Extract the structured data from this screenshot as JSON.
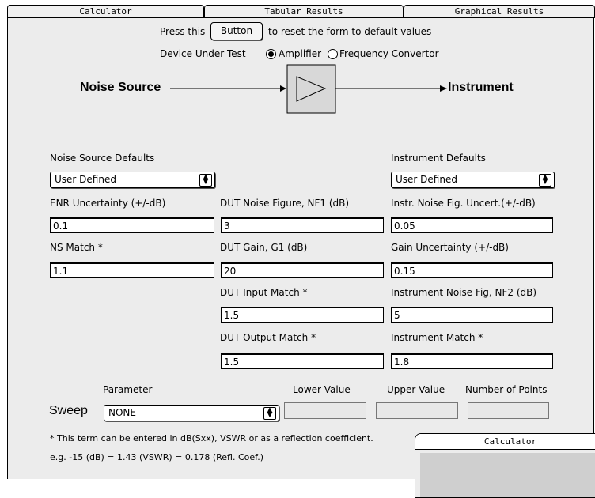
{
  "tabs": [
    "Calculator",
    "Tabular Results",
    "Graphical Results"
  ],
  "reset": {
    "prefix": "Press this",
    "button": "Button",
    "suffix": "to reset the form to default values"
  },
  "device": {
    "label": "Device Under Test",
    "option_amplifier": "Amplifier",
    "option_converter": "Frequency Convertor",
    "selected": "Amplifier"
  },
  "diagram": {
    "source": "Noise Source",
    "instrument": "Instrument"
  },
  "noise_source": {
    "defaults_label": "Noise Source Defaults",
    "defaults_value": "User Defined",
    "enr_label": "ENR Uncertainty (+/-dB)",
    "enr_value": "0.1",
    "match_label": "NS Match *",
    "match_value": "1.1"
  },
  "dut": {
    "nf_label": "DUT Noise Figure, NF1 (dB)",
    "nf_value": "3",
    "gain_label": "DUT Gain, G1 (dB)",
    "gain_value": "20",
    "input_label": "DUT Input Match *",
    "input_value": "1.5",
    "output_label": "DUT Output Match *",
    "output_value": "1.5"
  },
  "instrument": {
    "defaults_label": "Instrument Defaults",
    "defaults_value": "User Defined",
    "nf_uncert_label": "Instr. Noise Fig. Uncert.(+/-dB)",
    "nf_uncert_value": "0.05",
    "gain_uncert_label": "Gain Uncertainty (+/-dB)",
    "gain_uncert_value": "0.15",
    "nf2_label": "Instrument Noise Fig, NF2 (dB)",
    "nf2_value": "5",
    "match_label": "Instrument Match *",
    "match_value": "1.8"
  },
  "sweep": {
    "title": "Sweep",
    "parameter_label": "Parameter",
    "lower_label": "Lower Value",
    "upper_label": "Upper Value",
    "points_label": "Number of Points",
    "parameter_value": "NONE"
  },
  "notes": {
    "line1": "* This term can be entered in dB(Sxx), VSWR or as a reflection coefficient.",
    "line2": "e.g. -15 (dB) = 1.43 (VSWR) = 0.178 (Refl. Coef.)"
  },
  "mini_window": {
    "title": "Calculator"
  }
}
